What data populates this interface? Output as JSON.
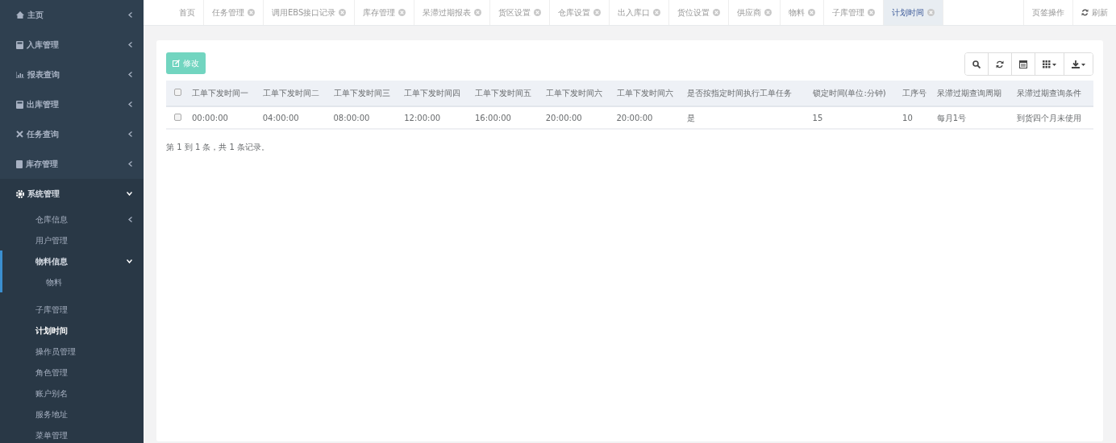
{
  "sidebar": {
    "items": [
      {
        "label": "主页",
        "expanded": false,
        "selected": false
      },
      {
        "label": "入库管理",
        "expanded": false,
        "selected": false
      },
      {
        "label": "报表查询",
        "expanded": false,
        "selected": false
      },
      {
        "label": "出库管理",
        "expanded": false,
        "selected": false
      },
      {
        "label": "任务查询",
        "expanded": false,
        "selected": false
      },
      {
        "label": "库存管理",
        "expanded": false,
        "selected": false
      },
      {
        "label": "系统管理",
        "expanded": true,
        "selected": false,
        "children": [
          {
            "label": "仓库信息",
            "expanded": false,
            "selected": false
          },
          {
            "label": "用户管理",
            "selected": false
          },
          {
            "label": "物料信息",
            "expanded": true,
            "selected": false,
            "children": [
              {
                "label": "物料",
                "selected": false
              }
            ]
          },
          {
            "label": "子库管理",
            "selected": false
          },
          {
            "label": "计划时间",
            "selected": true
          },
          {
            "label": "操作员管理",
            "selected": false
          },
          {
            "label": "角色管理",
            "selected": false
          },
          {
            "label": "账户别名",
            "selected": false
          },
          {
            "label": "服务地址",
            "selected": false
          },
          {
            "label": "菜单管理",
            "selected": false
          }
        ]
      }
    ]
  },
  "tabs": [
    {
      "label": "首页",
      "closable": false,
      "selected": false
    },
    {
      "label": "任务管理",
      "closable": true,
      "selected": false
    },
    {
      "label": "调用EBS接口记录",
      "closable": true,
      "selected": false
    },
    {
      "label": "库存管理",
      "closable": true,
      "selected": false
    },
    {
      "label": "呆滞过期报表",
      "closable": true,
      "selected": false
    },
    {
      "label": "货区设置",
      "closable": true,
      "selected": false
    },
    {
      "label": "仓库设置",
      "closable": true,
      "selected": false
    },
    {
      "label": "出入库口",
      "closable": true,
      "selected": false
    },
    {
      "label": "货位设置",
      "closable": true,
      "selected": false
    },
    {
      "label": "供应商",
      "closable": true,
      "selected": false
    },
    {
      "label": "物料",
      "closable": true,
      "selected": false
    },
    {
      "label": "子库管理",
      "closable": true,
      "selected": false
    },
    {
      "label": "计划时间",
      "closable": true,
      "selected": true
    }
  ],
  "tab_actions": {
    "menu": "页签操作",
    "refresh": "刷新"
  },
  "edit_button": "修改",
  "table": {
    "header_checked": false,
    "columns": [
      "工单下发时间一",
      "工单下发时间二",
      "工单下发时间三",
      "工单下发时间四",
      "工单下发时间五",
      "工单下发时间六",
      "工单下发时间六",
      "是否按指定时间执行工单任务",
      "锁定时间(单位:分钟)",
      "工序号",
      "呆滞过期查询周期",
      "呆滞过期查询条件"
    ],
    "rows": [
      {
        "checked": false,
        "cells": [
          "00:00:00",
          "04:00:00",
          "08:00:00",
          "12:00:00",
          "16:00:00",
          "20:00:00",
          "20:00:00",
          "是",
          "15",
          "10",
          "每月1号",
          "到货四个月未使用"
        ]
      }
    ]
  },
  "pagination": "第 1 到 1 条，共 1 条记录。"
}
